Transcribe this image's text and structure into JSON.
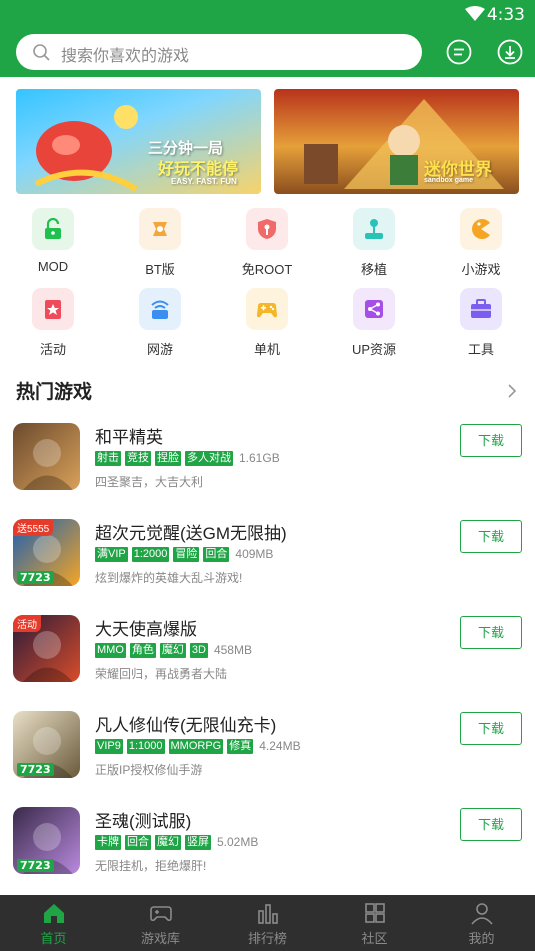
{
  "status_bar": {
    "time": "4:33"
  },
  "search": {
    "placeholder": "搜索你喜欢的游戏"
  },
  "banners": [
    {
      "headline": "三分钟一局",
      "subline": "好玩不能停",
      "tagline": "EASY. FAST. FUN"
    },
    {
      "headline": "迷你世界",
      "tagline": "sandbox game"
    }
  ],
  "categories": [
    {
      "label": "MOD",
      "icon": "lock-open-icon",
      "color": "#1fc04e",
      "bg": "#e6f7ea"
    },
    {
      "label": "BT版",
      "icon": "bt-icon",
      "color": "#f3a63a",
      "bg": "#fdf1e2"
    },
    {
      "label": "免ROOT",
      "icon": "shield-key-icon",
      "color": "#f06a6a",
      "bg": "#fde9e9"
    },
    {
      "label": "移植",
      "icon": "joystick-icon",
      "color": "#29c3b6",
      "bg": "#e1f6f4"
    },
    {
      "label": "小游戏",
      "icon": "pacman-icon",
      "color": "#f5a524",
      "bg": "#fef2e1"
    },
    {
      "label": "活动",
      "icon": "star-flag-icon",
      "color": "#f04b5a",
      "bg": "#fde6e8"
    },
    {
      "label": "网游",
      "icon": "network-icon",
      "color": "#3a8ff0",
      "bg": "#e5f0fd"
    },
    {
      "label": "单机",
      "icon": "gamepad-icon",
      "color": "#f5b62a",
      "bg": "#fef4de"
    },
    {
      "label": "UP资源",
      "icon": "share-icon",
      "color": "#a64ee8",
      "bg": "#f3e7fc"
    },
    {
      "label": "工具",
      "icon": "toolbox-icon",
      "color": "#7b5df0",
      "bg": "#ebe6fd"
    }
  ],
  "hot_section": {
    "title": "热门游戏"
  },
  "games": [
    {
      "name": "和平精英",
      "tags": [
        "射击",
        "竞技",
        "捏脸",
        "多人对战"
      ],
      "size": "1.61GB",
      "desc": "四圣聚吉，大吉大利",
      "button": "下载",
      "top_badge": "",
      "has7723": false,
      "art_a": "#6b4a2e",
      "art_b": "#d9a15a"
    },
    {
      "name": "超次元觉醒(送GM无限抽)",
      "tags": [
        "满VIP",
        "1:2000",
        "冒险",
        "回合"
      ],
      "size": "409MB",
      "desc": "炫到爆炸的英雄大乱斗游戏!",
      "button": "下载",
      "top_badge": "送5555",
      "has7723": true,
      "art_a": "#1a5fb4",
      "art_b": "#f5a524"
    },
    {
      "name": "大天使高爆版",
      "tags": [
        "MMO",
        "角色",
        "魔幻",
        "3D"
      ],
      "size": "458MB",
      "desc": "荣耀回归，再战勇者大陆",
      "button": "下载",
      "top_badge": "活动",
      "has7723": false,
      "art_a": "#2b1a3a",
      "art_b": "#d84d2a"
    },
    {
      "name": "凡人修仙传(无限仙充卡)",
      "tags": [
        "VIP9",
        "1:1000",
        "MMORPG",
        "修真"
      ],
      "size": "4.24MB",
      "desc": "正版IP授权修仙手游",
      "button": "下载",
      "top_badge": "",
      "has7723": true,
      "art_a": "#e9e0c8",
      "art_b": "#6a5a3a"
    },
    {
      "name": "圣魂(测试服)",
      "tags": [
        "卡牌",
        "回合",
        "魔幻",
        "竖屏"
      ],
      "size": "5.02MB",
      "desc": "无限挂机，拒绝爆肝!",
      "button": "下载",
      "top_badge": "",
      "has7723": true,
      "art_a": "#3a2a4a",
      "art_b": "#b98adf"
    }
  ],
  "bottom_nav": [
    {
      "label": "首页",
      "icon": "home-icon",
      "active": true
    },
    {
      "label": "游戏库",
      "icon": "gamepad-icon",
      "active": false
    },
    {
      "label": "排行榜",
      "icon": "ranking-icon",
      "active": false
    },
    {
      "label": "社区",
      "icon": "community-icon",
      "active": false
    },
    {
      "label": "我的",
      "icon": "profile-icon",
      "active": false
    }
  ],
  "colors": {
    "brand": "#1fa546",
    "nav_bg": "#2f2f2f",
    "muted_text": "#888888"
  }
}
